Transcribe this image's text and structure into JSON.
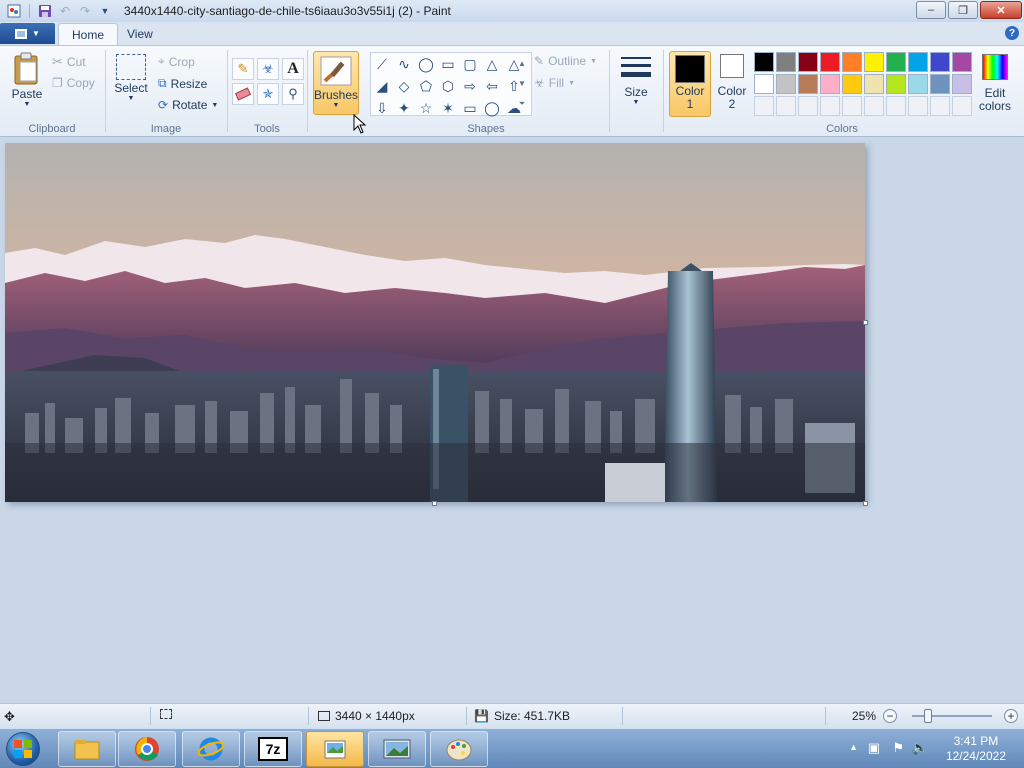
{
  "titlebar": {
    "title": "3440x1440-city-santiago-de-chile-ts6iaau3o3v55i1j (2) - Paint",
    "minimize": "–",
    "maximize": "❐",
    "close": "✕"
  },
  "tabs": {
    "home": "Home",
    "view": "View",
    "help": "?"
  },
  "ribbon": {
    "clipboard": {
      "label": "Clipboard",
      "paste": "Paste",
      "cut": "Cut",
      "copy": "Copy"
    },
    "image": {
      "label": "Image",
      "select": "Select",
      "crop": "Crop",
      "resize": "Resize",
      "rotate": "Rotate"
    },
    "tools": {
      "label": "Tools"
    },
    "brushes": {
      "label": "Brushes"
    },
    "shapes": {
      "label": "Shapes",
      "outline": "Outline",
      "fill": "Fill"
    },
    "size": {
      "label": "Size"
    },
    "colors": {
      "label": "Colors",
      "color1": "Color\n1",
      "color1_line1": "Color",
      "color1_line2": "1",
      "color2_line1": "Color",
      "color2_line2": "2",
      "edit_line1": "Edit",
      "edit_line2": "colors",
      "color1_value": "#000000",
      "color2_value": "#ffffff",
      "palette_row1": [
        "#000000",
        "#7f7f7f",
        "#880015",
        "#ed1c24",
        "#ff7f27",
        "#fff200",
        "#22b14c",
        "#00a2e8",
        "#3f48cc",
        "#a349a4"
      ],
      "palette_row2": [
        "#ffffff",
        "#c3c3c3",
        "#b97a57",
        "#ffaec9",
        "#ffc90e",
        "#efe4b0",
        "#b5e61d",
        "#99d9ea",
        "#7092be",
        "#c8bfe7"
      ]
    }
  },
  "statusbar": {
    "dimensions": "3440 × 1440px",
    "size": "Size: 451.7KB",
    "zoom": "25%",
    "zoom_level": 0.25
  },
  "taskbar": {
    "time": "3:41 PM",
    "date": "12/24/2022"
  }
}
